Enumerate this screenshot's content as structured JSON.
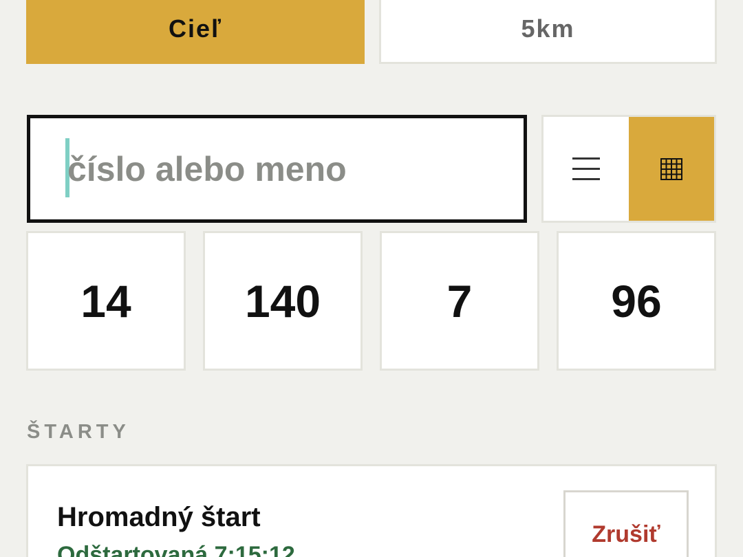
{
  "mode_tabs": {
    "finish_label": "Cieľ",
    "distance_label": "5km"
  },
  "search": {
    "placeholder": "číslo alebo meno"
  },
  "view_toggle": {
    "list_icon": "list-icon",
    "grid_icon": "grid-icon",
    "active": "grid"
  },
  "stats": [
    {
      "value": "14"
    },
    {
      "value": "140"
    },
    {
      "value": "7"
    },
    {
      "value": "96"
    }
  ],
  "starts_section": {
    "heading": "ŠTARTY",
    "items": [
      {
        "name": "Hromadný štart",
        "status": "Odštartovaná 7:15:12",
        "cancel_label": "Zrušiť"
      }
    ]
  },
  "colors": {
    "accent": "#d9a93c",
    "background": "#f1f1ed",
    "status_green": "#2d6a3e",
    "cancel_red": "#b03a2e"
  }
}
